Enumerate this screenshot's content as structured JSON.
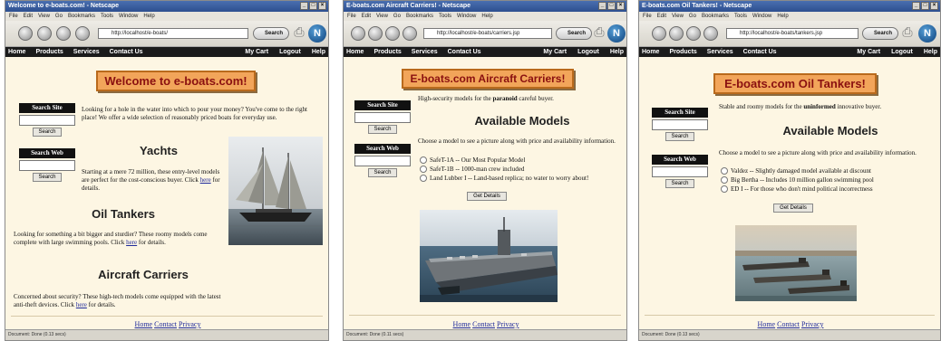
{
  "browser": {
    "menu": [
      "File",
      "Edit",
      "View",
      "Go",
      "Bookmarks",
      "Tools",
      "Window",
      "Help"
    ],
    "search_label": "Search",
    "minimize": "_",
    "maximize": "□",
    "close": "×",
    "print_glyph": "⎙",
    "logo_letter": "N"
  },
  "nav": {
    "left": [
      "Home",
      "Products",
      "Services",
      "Contact Us"
    ],
    "right": [
      "My Cart",
      "Logout",
      "Help"
    ]
  },
  "search_site": {
    "title": "Search Site",
    "button": "Search"
  },
  "search_web": {
    "title": "Search Web",
    "button": "Search"
  },
  "footer_links": [
    "Home",
    "Contact",
    "Privacy"
  ],
  "windows": [
    {
      "window_title": "Welcome to e-boats.com! - Netscape",
      "url": "http://localhost/e-boats/",
      "status": "Document: Done (0.13 secs)",
      "banner": "Welcome to e-boats.com!",
      "intro": "Looking for a hole in the water into which to pour your money? You've come to the right place! We offer a wide selection of reasonably priced boats for everyday use.",
      "sections": [
        {
          "heading": "Yachts",
          "text_before": "Starting at a mere 72 million, these entry-level models are perfect for the cost-conscious buyer. Click",
          "link": "here",
          "text_after": "for details."
        },
        {
          "heading": "Oil Tankers",
          "text_before": "Looking for something a bit bigger and sturdier? These roomy models come complete with large swimming pools. Click",
          "link": "here",
          "text_after": "for details."
        },
        {
          "heading": "Aircraft Carriers",
          "text_before": "Concerned about security? These high-tech models come equipped with the latest anti-theft devices. Click",
          "link": "here",
          "text_after": "for details."
        }
      ]
    },
    {
      "window_title": "E-boats.com Aircraft Carriers! - Netscape",
      "url": "http://localhost/e-boats/carriers.jsp",
      "status": "Document: Done (0.11 secs)",
      "banner": "E-boats.com Aircraft Carriers!",
      "tagline_before": "High-security models for the",
      "tagline_bold": "paranoid",
      "tagline_after": "careful buyer.",
      "models_heading": "Available Models",
      "choose_text": "Choose a model to see a picture along with price and availability information.",
      "models": [
        "SafeT-1A -- Our Most Popular Model",
        "SafeT-1B -- 1000-man crew included",
        "Land Lubber I -- Land-based replica; no water to worry about!"
      ],
      "get_details": "Get Details"
    },
    {
      "window_title": "E-boats.com Oil Tankers! - Netscape",
      "url": "http://localhost/e-boats/tankers.jsp",
      "status": "Document: Done (0.13 secs)",
      "banner": "E-boats.com Oil Tankers!",
      "tagline_before": "Stable and roomy models for the",
      "tagline_bold": "uninformed",
      "tagline_after": "innovative buyer.",
      "models_heading": "Available Models",
      "choose_text": "Choose a model to see a picture along with price and availability information.",
      "models": [
        "Valdez -- Slightly damaged model available at discount",
        "Big Bertha -- Includes 10 million gallon swimming pool",
        "ED I -- For those who don't mind political incorrectness"
      ],
      "get_details": "Get Details"
    }
  ]
}
